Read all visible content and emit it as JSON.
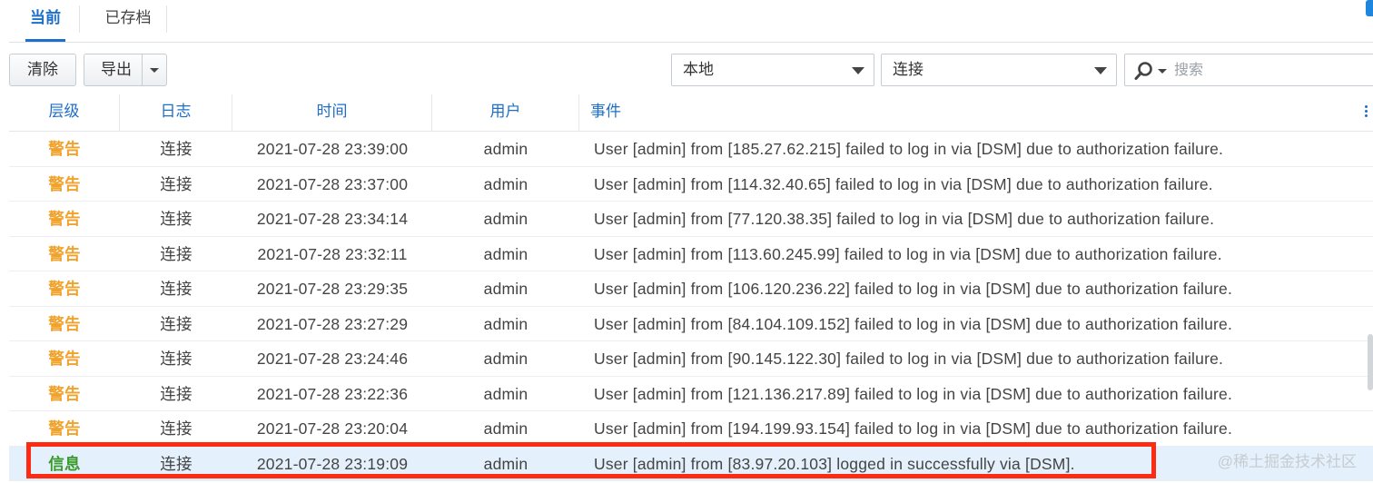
{
  "tabs": [
    {
      "label": "当前",
      "active": true
    },
    {
      "label": "已存档",
      "active": false
    }
  ],
  "toolbar": {
    "clear_label": "清除",
    "export_label": "导出",
    "location_select": "本地",
    "type_select": "连接",
    "search_placeholder": "搜索"
  },
  "columns": {
    "level": "层级",
    "log": "日志",
    "time": "时间",
    "user": "用户",
    "event": "事件"
  },
  "colors": {
    "warn": "#f0a22b",
    "info": "#3a9a2c",
    "header": "#1e6fc8",
    "highlight_border": "#ff2a12"
  },
  "rows": [
    {
      "level": "警告",
      "level_type": "warn",
      "log": "连接",
      "time": "2021-07-28 23:39:00",
      "user": "admin",
      "event": "User [admin] from [185.27.62.215] failed to log in via [DSM] due to authorization failure."
    },
    {
      "level": "警告",
      "level_type": "warn",
      "log": "连接",
      "time": "2021-07-28 23:37:00",
      "user": "admin",
      "event": "User [admin] from [114.32.40.65] failed to log in via [DSM] due to authorization failure."
    },
    {
      "level": "警告",
      "level_type": "warn",
      "log": "连接",
      "time": "2021-07-28 23:34:14",
      "user": "admin",
      "event": "User [admin] from [77.120.38.35] failed to log in via [DSM] due to authorization failure."
    },
    {
      "level": "警告",
      "level_type": "warn",
      "log": "连接",
      "time": "2021-07-28 23:32:11",
      "user": "admin",
      "event": "User [admin] from [113.60.245.99] failed to log in via [DSM] due to authorization failure."
    },
    {
      "level": "警告",
      "level_type": "warn",
      "log": "连接",
      "time": "2021-07-28 23:29:35",
      "user": "admin",
      "event": "User [admin] from [106.120.236.22] failed to log in via [DSM] due to authorization failure."
    },
    {
      "level": "警告",
      "level_type": "warn",
      "log": "连接",
      "time": "2021-07-28 23:27:29",
      "user": "admin",
      "event": "User [admin] from [84.104.109.152] failed to log in via [DSM] due to authorization failure."
    },
    {
      "level": "警告",
      "level_type": "warn",
      "log": "连接",
      "time": "2021-07-28 23:24:46",
      "user": "admin",
      "event": "User [admin] from [90.145.122.30] failed to log in via [DSM] due to authorization failure."
    },
    {
      "level": "警告",
      "level_type": "warn",
      "log": "连接",
      "time": "2021-07-28 23:22:36",
      "user": "admin",
      "event": "User [admin] from [121.136.217.89] failed to log in via [DSM] due to authorization failure."
    },
    {
      "level": "警告",
      "level_type": "warn",
      "log": "连接",
      "time": "2021-07-28 23:20:04",
      "user": "admin",
      "event": "User [admin] from [194.199.93.154] failed to log in via [DSM] due to authorization failure."
    },
    {
      "level": "信息",
      "level_type": "info",
      "log": "连接",
      "time": "2021-07-28 23:19:09",
      "user": "admin",
      "event": "User [admin] from [83.97.20.103] logged in successfully via [DSM].",
      "selected": true
    }
  ],
  "watermark": "@稀土掘金技术社区"
}
